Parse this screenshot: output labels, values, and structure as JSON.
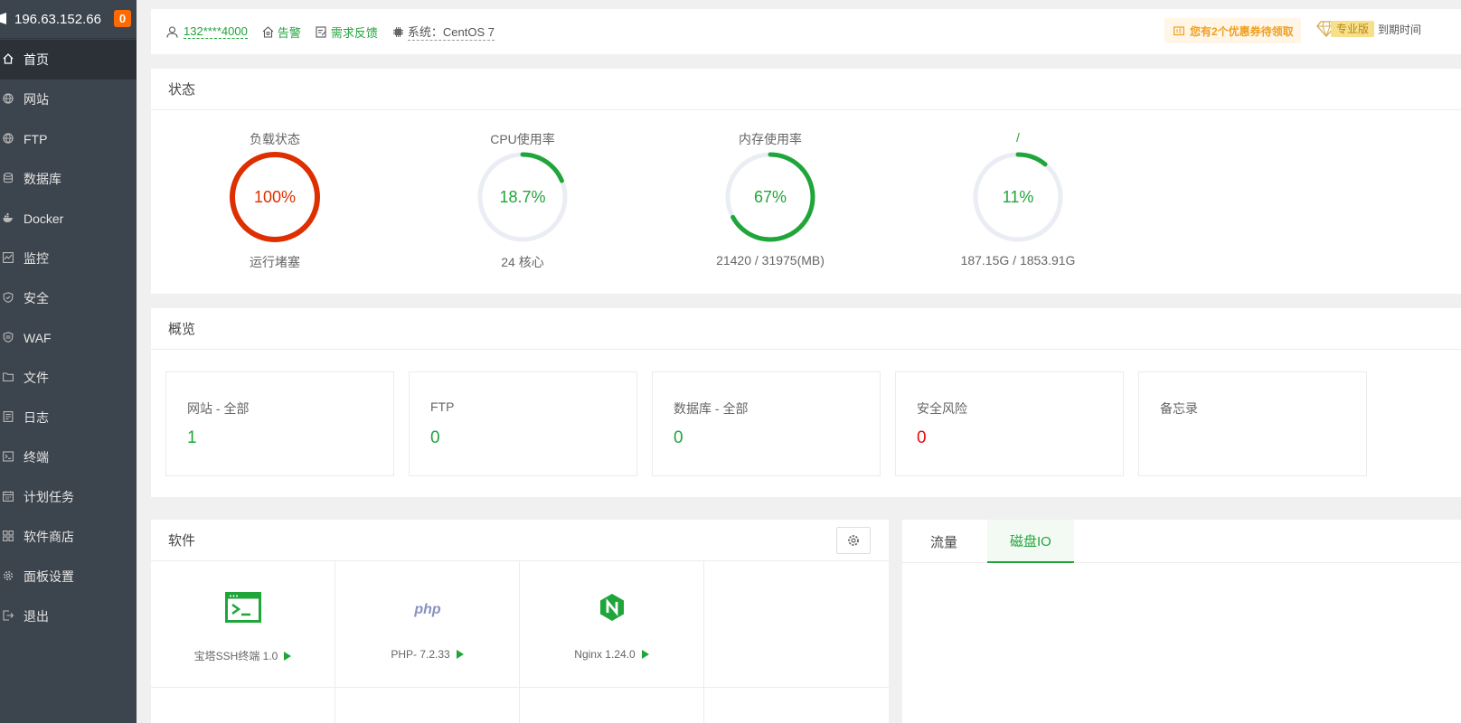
{
  "sidebar": {
    "server_ip": "196.63.152.66",
    "badge_count": "0",
    "items": [
      {
        "label": "首页",
        "icon": "home-icon"
      },
      {
        "label": "网站",
        "icon": "globe-icon"
      },
      {
        "label": "FTP",
        "icon": "globe-icon"
      },
      {
        "label": "数据库",
        "icon": "database-icon"
      },
      {
        "label": "Docker",
        "icon": "docker-icon"
      },
      {
        "label": "监控",
        "icon": "monitor-icon"
      },
      {
        "label": "安全",
        "icon": "shield-icon"
      },
      {
        "label": "WAF",
        "icon": "waf-shield-icon"
      },
      {
        "label": "文件",
        "icon": "folder-icon"
      },
      {
        "label": "日志",
        "icon": "log-icon"
      },
      {
        "label": "终端",
        "icon": "terminal-icon"
      },
      {
        "label": "计划任务",
        "icon": "calendar-icon"
      },
      {
        "label": "软件商店",
        "icon": "apps-icon"
      },
      {
        "label": "面板设置",
        "icon": "gear-icon"
      },
      {
        "label": "退出",
        "icon": "logout-icon"
      }
    ]
  },
  "topbar": {
    "user": "132****4000",
    "alert": "告警",
    "feedback": "需求反馈",
    "system": "系统：CentOS 7",
    "coupon": "您有2个优惠券待领取",
    "pro_badge": "专业版",
    "expire": "到期时间"
  },
  "status": {
    "title": "状态",
    "gauges": [
      {
        "title": "负载状态",
        "value_text": "100%",
        "percent": 100,
        "sub": "运行堵塞",
        "color": "#dd2f00"
      },
      {
        "title": "CPU使用率",
        "value_text": "18.7%",
        "percent": 18.7,
        "sub": "24 核心",
        "color": "#20a53a"
      },
      {
        "title": "内存使用率",
        "value_text": "67%",
        "percent": 67,
        "sub": "21420 / 31975(MB)",
        "color": "#20a53a"
      },
      {
        "title": "/",
        "value_text": "11%",
        "percent": 11,
        "sub": "187.15G / 1853.91G",
        "color": "#20a53a"
      }
    ]
  },
  "overview": {
    "title": "概览",
    "cards": [
      {
        "label": "网站 - 全部",
        "value": "1"
      },
      {
        "label": "FTP",
        "value": "0"
      },
      {
        "label": "数据库 - 全部",
        "value": "0"
      },
      {
        "label": "安全风险",
        "value": "0"
      },
      {
        "label": "备忘录",
        "value": ""
      }
    ]
  },
  "software": {
    "title": "软件",
    "items": [
      {
        "name": "宝塔SSH终端 1.0",
        "icon": "ssh-terminal-icon"
      },
      {
        "name": "PHP- 7.2.33",
        "icon": "php-icon"
      },
      {
        "name": "Nginx 1.24.0",
        "icon": "nginx-icon"
      }
    ]
  },
  "traffic": {
    "tabs": [
      "流量",
      "磁盘IO"
    ],
    "active_tab": 1
  },
  "colors": {
    "accent": "#20a53a",
    "danger": "#dd2f00",
    "risk": "#ef0808",
    "sidebar": "#3c444d"
  }
}
